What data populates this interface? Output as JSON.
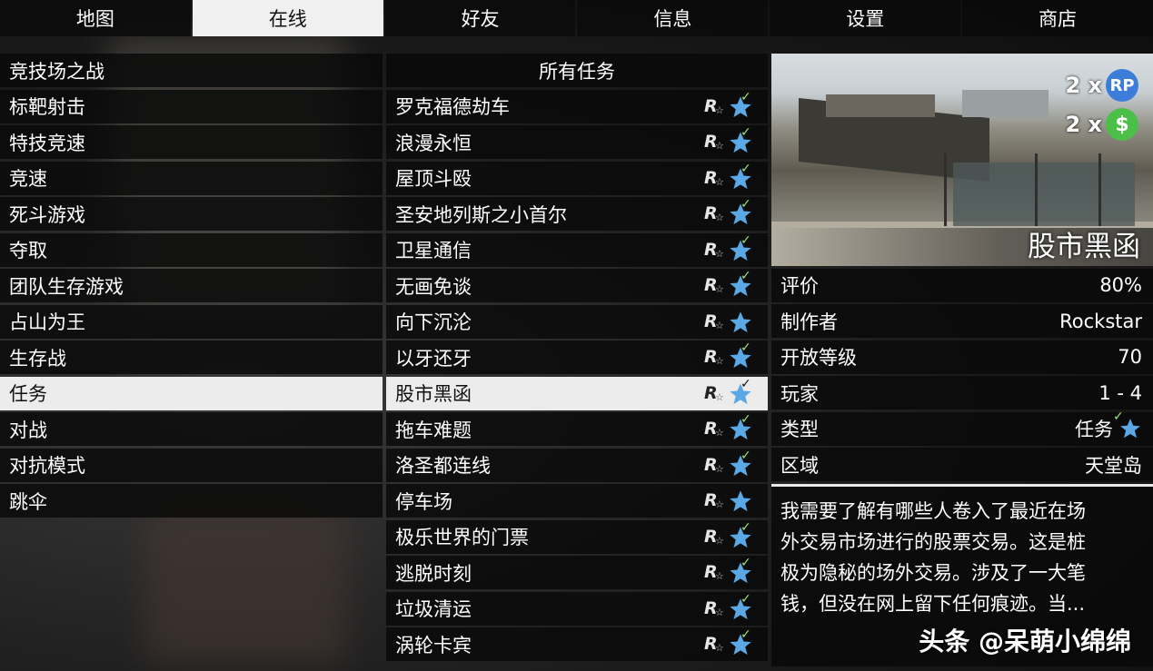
{
  "tabs": [
    "地图",
    "在线",
    "好友",
    "信息",
    "设置",
    "商店"
  ],
  "active_tab": 1,
  "left_list": [
    "竞技场之战",
    "标靶射击",
    "特技竞速",
    "竞速",
    "死斗游戏",
    "夺取",
    "团队生存游戏",
    "占山为王",
    "生存战",
    "任务",
    "对战",
    "对抗模式",
    "跳伞"
  ],
  "left_selected": 9,
  "mid_header": "所有任务",
  "missions": [
    {
      "name": "罗克福德劫车",
      "completed": true
    },
    {
      "name": "浪漫永恒",
      "completed": true
    },
    {
      "name": "屋顶斗殴",
      "completed": true
    },
    {
      "name": "圣安地列斯之小首尔",
      "completed": true
    },
    {
      "name": "卫星通信",
      "completed": true
    },
    {
      "name": "无画免谈",
      "completed": true
    },
    {
      "name": "向下沉沦",
      "completed": false
    },
    {
      "name": "以牙还牙",
      "completed": true
    },
    {
      "name": "股市黑函",
      "completed": true
    },
    {
      "name": "拖车难题",
      "completed": true
    },
    {
      "name": "洛圣都连线",
      "completed": true
    },
    {
      "name": "停车场",
      "completed": false
    },
    {
      "name": "极乐世界的门票",
      "completed": true
    },
    {
      "name": "逃脱时刻",
      "completed": true
    },
    {
      "name": "垃圾清运",
      "completed": true
    },
    {
      "name": "涡轮卡宾",
      "completed": true
    }
  ],
  "mission_selected": 8,
  "detail": {
    "title": "股市黑函",
    "rp_multiplier": "2 x",
    "rp_label": "RP",
    "cash_multiplier": "2 x",
    "cash_label": "$",
    "rows": [
      {
        "label": "评价",
        "value": "80%"
      },
      {
        "label": "制作者",
        "value": "Rockstar"
      },
      {
        "label": "开放等级",
        "value": "70"
      },
      {
        "label": "玩家",
        "value": "1 - 4"
      },
      {
        "label": "类型",
        "value": "任务"
      },
      {
        "label": "区域",
        "value": "天堂岛"
      }
    ],
    "description": [
      "我需要了解有哪些人卷入了最近在场",
      "外交易市场进行的股票交易。这是桩",
      "极为隐秘的场外交易。涉及了一大笔",
      "钱，但没在网上留下任何痕迹。当..."
    ]
  },
  "watermark": "头条 @呆萌小绵绵",
  "icons": {
    "rockstar": "rockstar-r-logo",
    "star": "blue-star-icon",
    "check": "check-icon"
  },
  "colors": {
    "star_blue": "#5aa9e6",
    "check_green": "#9fe57c",
    "rp_blue": "#3b7dd8",
    "cash_green": "#4bbf48"
  }
}
